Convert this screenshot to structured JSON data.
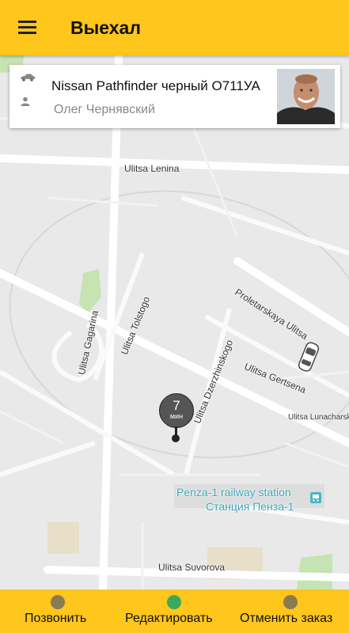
{
  "header": {
    "title": "Выехал",
    "menu_icon": "hamburger-menu-icon"
  },
  "driver_card": {
    "car": "Nissan Pathfinder черный О711УА",
    "driver": "Олег Чернявский",
    "car_icon": "car-icon",
    "person_icon": "person-icon",
    "avatar": "driver-photo"
  },
  "map": {
    "streets": [
      "Ulitsa Lenina",
      "Proletarskaya Ulitsa",
      "Ulitsa Tolstogo",
      "Ulitsa Gagarina",
      "Ulitsa Dzerzhinskogo",
      "Ulitsa Gertsena",
      "Ulitsa Lunacharsko",
      "Ulitsa Suvorova"
    ],
    "station_en": "Penza-1 railway station",
    "station_ru": "Станция Пенза-1",
    "eta": {
      "value": "7",
      "unit": "мин"
    }
  },
  "actions": [
    {
      "label": "Позвонить",
      "icon": "phone-icon",
      "color": "#8a7a52"
    },
    {
      "label": "Редактировать",
      "icon": "pencil-icon",
      "color": "#3aaa5a"
    },
    {
      "label": "Отменить заказ",
      "icon": "cancel-icon",
      "color": "#8a7a52"
    }
  ],
  "colors": {
    "accent": "#ffc61c",
    "map_bg": "#e9e9e9",
    "park": "#c6e3b3"
  }
}
